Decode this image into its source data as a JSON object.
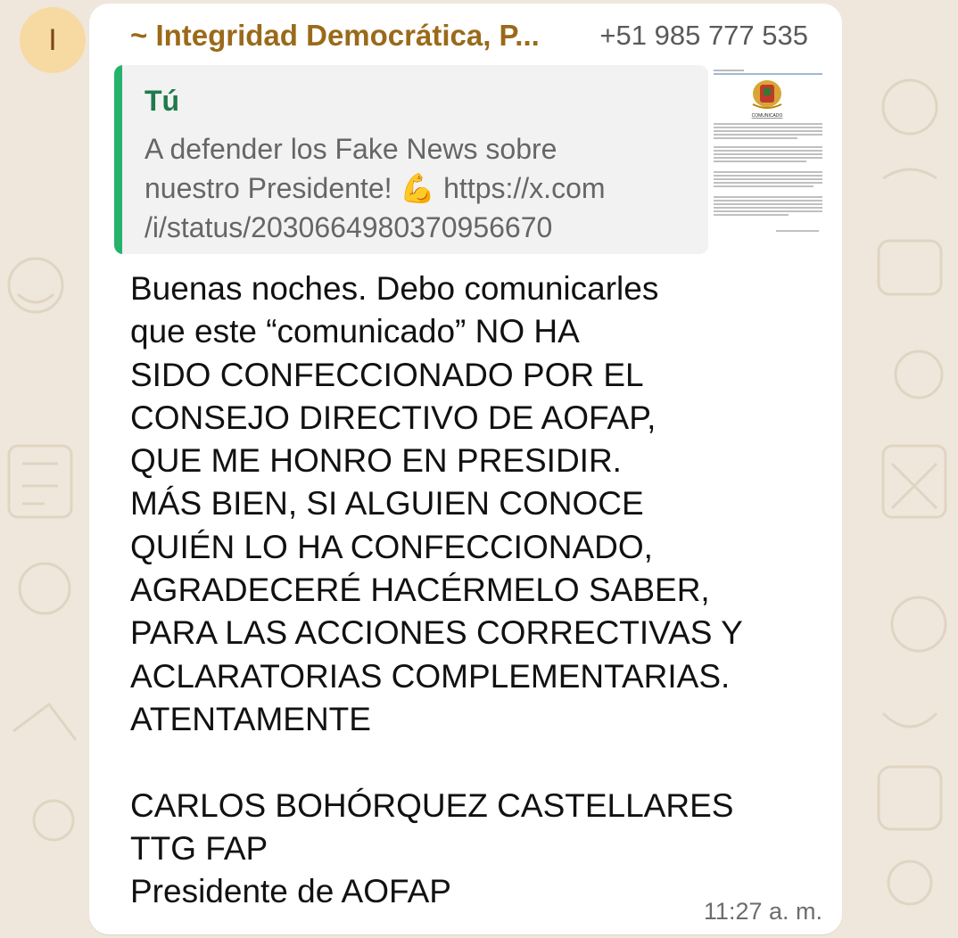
{
  "chat": {
    "avatar_initial": "I",
    "sender_name": "~ Integridad Democrática, P...",
    "sender_phone": "+51 985 777 535",
    "quoted": {
      "author": "Tú",
      "text": "A defender los Fake News sobre\nnuestro Presidente! 💪 https://x.com\n/i/status/2030664980370956670",
      "thumbnail_heading": "COMUNICADO"
    },
    "message": "Buenas noches. Debo comunicarles\nque este “comunicado” NO HA\nSIDO CONFECCIONADO POR EL\nCONSEJO DIRECTIVO DE AOFAP,\nQUE ME HONRO EN PRESIDIR.\nMÁS BIEN, SI ALGUIEN CONOCE\nQUIÉN LO HA CONFECCIONADO,\nAGRADECERÉ HACÉRMELO SABER,\nPARA LAS ACCIONES CORRECTIVAS Y\nACLARATORIAS COMPLEMENTARIAS.\nATENTAMENTE\n\nCARLOS BOHÓRQUEZ CASTELLARES\nTTG FAP\nPresidente de AOFAP",
    "time": "11:27 a. m."
  },
  "colors": {
    "wallpaper": "#efe7dc",
    "bubble": "#ffffff",
    "sender": "#9a6a1a",
    "quote_bar": "#25b36b",
    "quote_author": "#1f7a4c"
  }
}
